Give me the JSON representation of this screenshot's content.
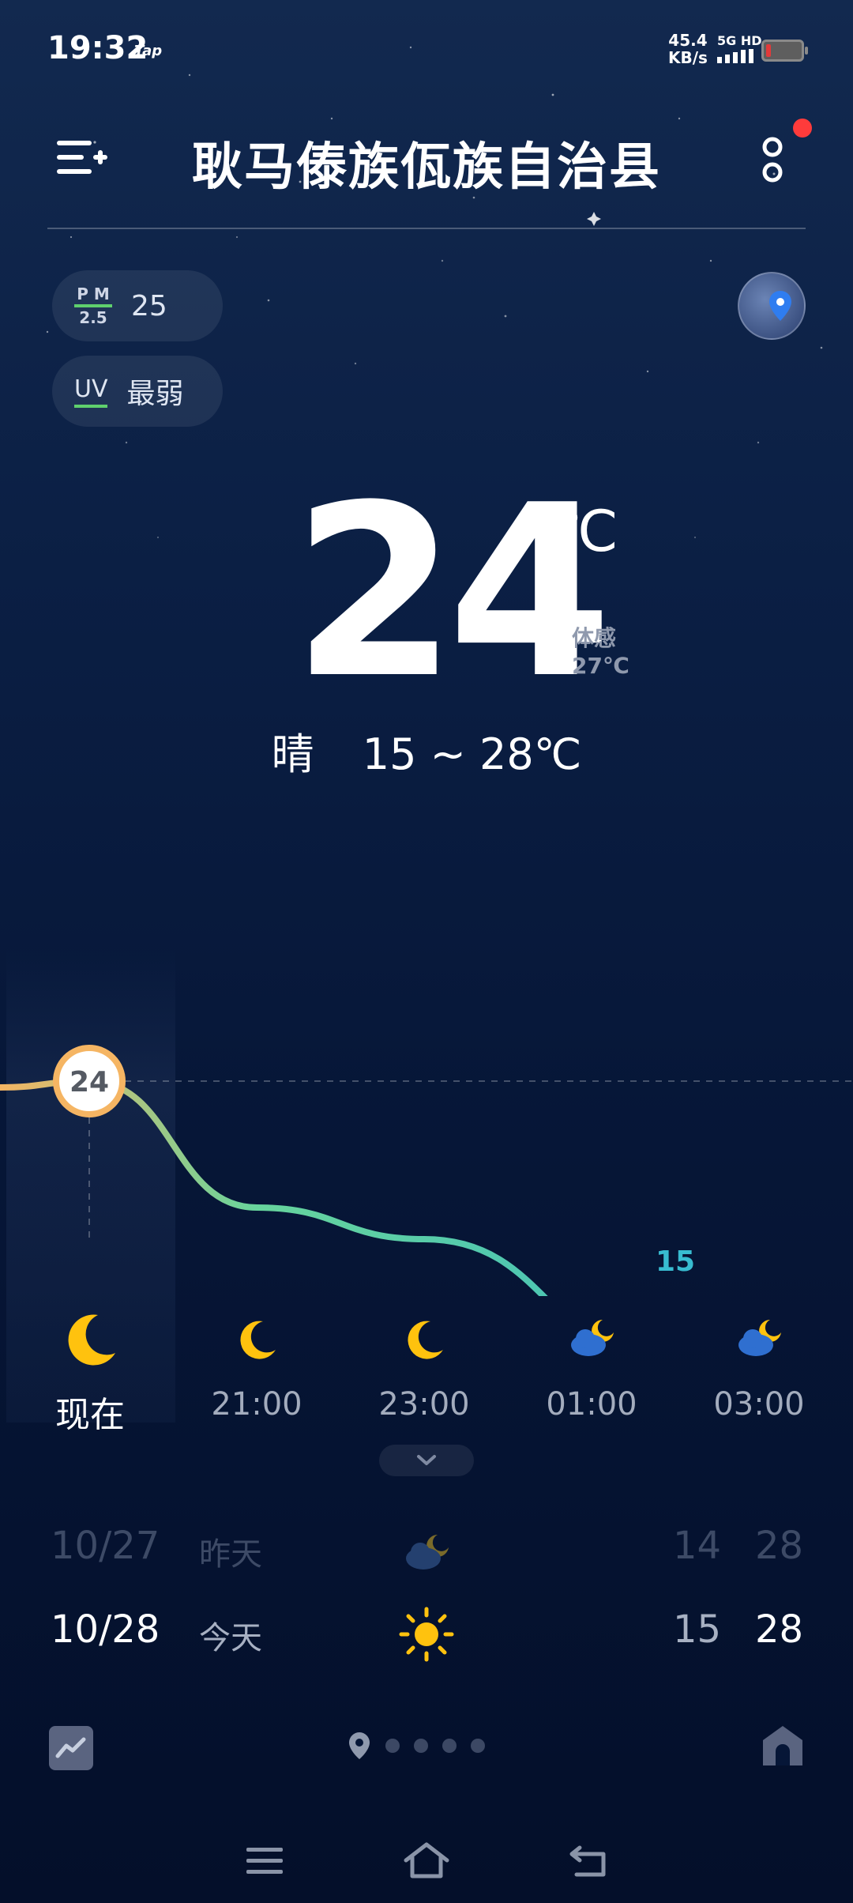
{
  "status_bar": {
    "time": "19:32",
    "app_tag": "Tap",
    "net_speed_value": "45.4",
    "net_speed_unit": "KB/s",
    "network": "5G HD"
  },
  "header": {
    "city": "耿马傣族佤族自治县"
  },
  "air": {
    "pm_label_top": "P M",
    "pm_label_bottom": "2.5",
    "pm_value": "25",
    "uv_label": "UV",
    "uv_value": "最弱"
  },
  "current": {
    "temperature": "24",
    "unit": "℃",
    "feels_label": "体感",
    "feels_value": "27℃",
    "condition": "晴",
    "range": "15 ~ 28℃"
  },
  "chart_data": {
    "type": "line",
    "x": [
      "现在",
      "21:00",
      "23:00",
      "01:00",
      "03:00"
    ],
    "values": [
      24,
      20,
      19,
      15,
      15
    ],
    "highlight_label": "24",
    "low_label": "15",
    "colors": {
      "start": "#f5b563",
      "mid": "#67d49c",
      "end": "#33b8c9"
    }
  },
  "hourly": [
    {
      "time": "现在",
      "icon": "moon-icon"
    },
    {
      "time": "21:00",
      "icon": "moon-icon"
    },
    {
      "time": "23:00",
      "icon": "moon-icon"
    },
    {
      "time": "01:00",
      "icon": "cloudy-moon-icon"
    },
    {
      "time": "03:00",
      "icon": "cloudy-moon-icon"
    }
  ],
  "daily": [
    {
      "date": "10/27",
      "label": "昨天",
      "icon": "cloudy-moon-icon",
      "low": "14",
      "high": "28"
    },
    {
      "date": "10/28",
      "label": "今天",
      "icon": "sun-icon",
      "low": "15",
      "high": "28"
    }
  ],
  "colors": {
    "accent_orange": "#f5b563",
    "accent_green": "#5fd06d",
    "icon_yellow": "#ffc20e",
    "notification": "#ff3b3b"
  }
}
